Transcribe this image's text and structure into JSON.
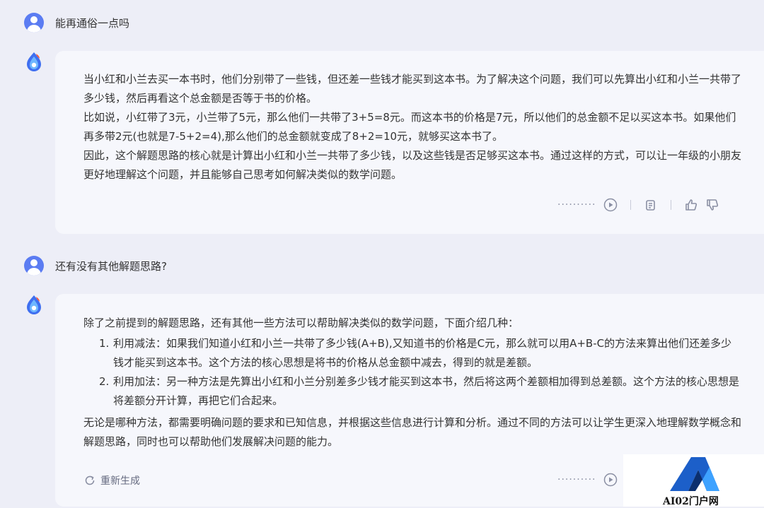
{
  "conversation": [
    {
      "role": "user",
      "text": "能再通俗一点吗"
    },
    {
      "role": "assistant",
      "paragraphs": [
        "当小红和小兰去买一本书时，他们分别带了一些钱，但还差一些钱才能买到这本书。为了解决这个问题，我们可以先算出小红和小兰一共带了多少钱，然后再看这个总金额是否等于书的价格。",
        "比如说，小红带了3元，小兰带了5元，那么他们一共带了3+5=8元。而这本书的价格是7元，所以他们的总金额不足以买这本书。如果他们再多带2元(也就是7-5+2=4),那么他们的总金额就变成了8+2=10元，就够买这本书了。",
        "因此，这个解题思路的核心就是计算出小红和小兰一共带了多少钱，以及这些钱是否足够买这本书。通过这样的方式，可以让一年级的小朋友更好地理解这个问题，并且能够自己思考如何解决类似的数学问题。"
      ]
    },
    {
      "role": "user",
      "text": "还有没有其他解题思路?"
    },
    {
      "role": "assistant",
      "intro": "除了之前提到的解题思路，还有其他一些方法可以帮助解决类似的数学问题，下面介绍几种：",
      "list": [
        {
          "num": "1.",
          "text": "利用减法：如果我们知道小红和小兰一共带了多少钱(A+B),又知道书的价格是C元，那么就可以用A+B-C的方法来算出他们还差多少钱才能买到这本书。这个方法的核心思想是将书的价格从总金额中减去，得到的就是差额。"
        },
        {
          "num": "2.",
          "text": "利用加法：另一种方法是先算出小红和小兰分别差多少钱才能买到这本书，然后将这两个差额相加得到总差额。这个方法的核心思想是将差额分开计算，再把它们合起来。"
        }
      ],
      "outro": "无论是哪种方法，都需要明确问题的要求和已知信息，并根据这些信息进行计算和分析。通过不同的方法可以让学生更深入地理解数学概念和解题思路，同时也可以帮助他们发展解决问题的能力。",
      "regenerate_label": "重新生成"
    }
  ],
  "actions": {
    "play_dots": "··········",
    "icons": [
      "play-icon",
      "copy-icon",
      "thumbs-up-icon",
      "thumbs-down-icon",
      "refresh-icon"
    ]
  },
  "brand": {
    "text": "AI02门户网"
  },
  "colors": {
    "background": "#edeef7",
    "card": "#f6f7fc",
    "user_avatar": "#5b7cf2",
    "icon_gray": "#8a8fa3"
  }
}
